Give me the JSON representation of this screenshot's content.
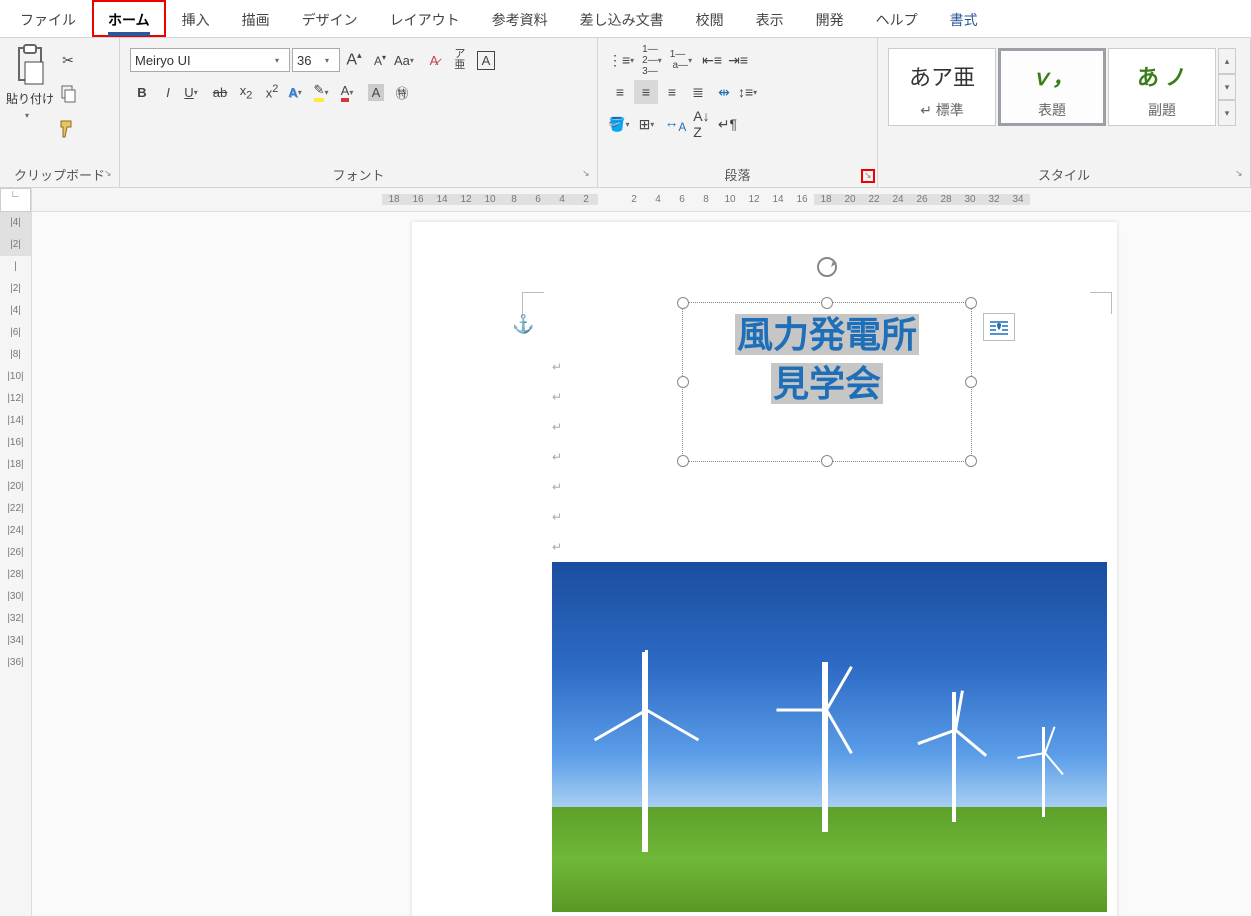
{
  "tabs": {
    "file": "ファイル",
    "home": "ホーム",
    "insert": "挿入",
    "draw": "描画",
    "design": "デザイン",
    "layout": "レイアウト",
    "references": "参考資料",
    "mailings": "差し込み文書",
    "review": "校閲",
    "view": "表示",
    "developer": "開発",
    "help": "ヘルプ",
    "format": "書式"
  },
  "groups": {
    "clipboard": "クリップボード",
    "font": "フォント",
    "paragraph": "段落",
    "styles": "スタイル"
  },
  "clipboard": {
    "paste": "貼り付け"
  },
  "font": {
    "name": "Meiryo UI",
    "size": "36"
  },
  "styles": {
    "normal": {
      "sample": "あア亜",
      "name": "↵ 標準"
    },
    "title": {
      "sample": "ｖ，",
      "name": "表題"
    },
    "subtitle": {
      "sample": "あ ノ",
      "name": "副題"
    }
  },
  "textbox": {
    "line1": "風力発電所",
    "line2": "見学会"
  },
  "hruler": {
    "neg": [
      "18",
      "16",
      "14",
      "12",
      "10",
      "8",
      "6",
      "4",
      "2"
    ],
    "pos": [
      "",
      "2",
      "4",
      "6",
      "8",
      "10",
      "12",
      "14",
      "16"
    ],
    "after": [
      "18",
      "20",
      "22",
      "24",
      "26",
      "28",
      "30",
      "32",
      "34"
    ]
  },
  "vruler": {
    "neg": [
      "|4|",
      "|2|"
    ],
    "pos": [
      "|",
      "|2|",
      "|4|",
      "|6|",
      "|8|",
      "|10|",
      "|12|",
      "|14|",
      "|16|",
      "|18|",
      "|20|",
      "|22|",
      "|24|",
      "|26|",
      "|28|",
      "|30|",
      "|32|",
      "|34|",
      "|36|"
    ]
  }
}
